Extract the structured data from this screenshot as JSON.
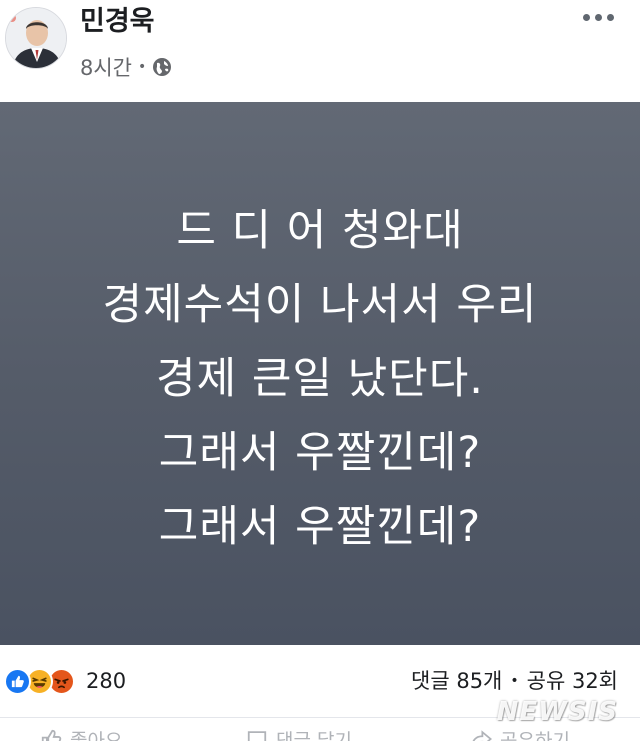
{
  "author": {
    "name": "민경욱",
    "timestamp": "8시간",
    "privacy_icon": "globe-icon"
  },
  "post": {
    "lines": [
      "드 디 어 청와대",
      "경제수석이 나서서 우리",
      "경제 큰일 났단다.",
      "그래서 우짤낀데?",
      "그래서 우짤낀데?"
    ],
    "background": "#585f6c",
    "text_color": "#ffffff"
  },
  "reactions": {
    "icons": [
      "like-icon",
      "haha-icon",
      "angry-icon"
    ],
    "count": "280"
  },
  "stats": {
    "comments": "댓글 85개",
    "shares": "공유 32회"
  },
  "actions": {
    "like": "좋아요",
    "comment": "댓글 달기",
    "share": "공유하기"
  },
  "watermark": "NEWSIS"
}
